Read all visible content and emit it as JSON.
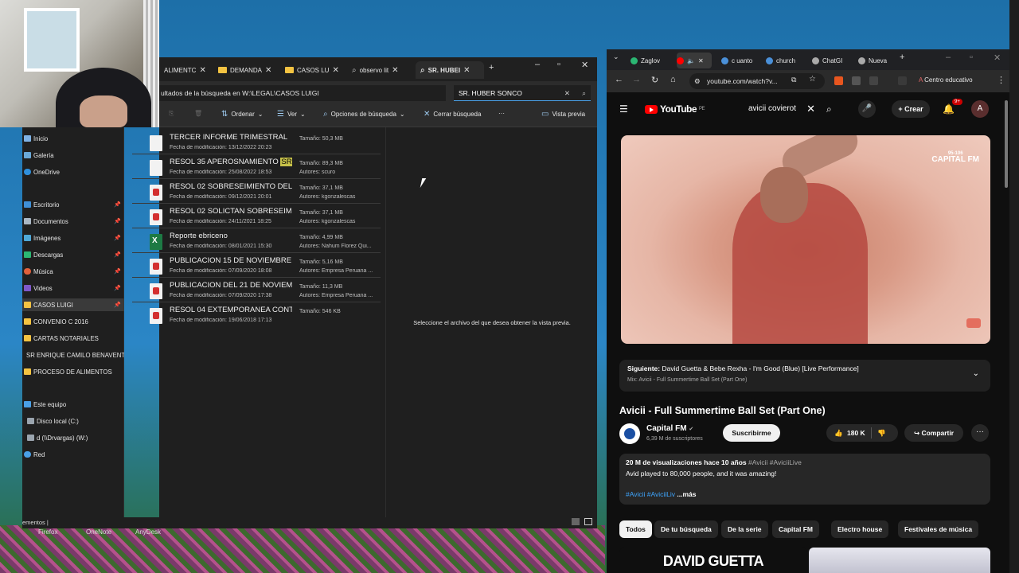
{
  "desktop": {
    "taskbar_labels": [
      "Firefox",
      "OneNote",
      "AnyDesk"
    ]
  },
  "explorer": {
    "tabs": [
      {
        "label": "ALIMENTC",
        "icon": "folder-icon"
      },
      {
        "label": "DEMANDA",
        "icon": "folder-icon"
      },
      {
        "label": "CASOS LU",
        "icon": "folder-icon"
      },
      {
        "label": "observo lit",
        "icon": "search-icon"
      },
      {
        "label": "SR. HUBEI",
        "icon": "search-icon"
      }
    ],
    "address": "ultados de la búsqueda en W:\\LEGAL\\CASOS LUIGI",
    "search_value": "SR. HUBER SONCO",
    "toolbar": {
      "sort": "Ordenar",
      "view": "Ver",
      "search_options": "Opciones de búsqueda",
      "close_search": "Cerrar búsqueda",
      "more": "···",
      "preview": "Vista previa"
    },
    "nav": [
      {
        "label": "Inicio",
        "icon": "home-icon",
        "pinned": false
      },
      {
        "label": "Galería",
        "icon": "gallery-icon",
        "pinned": false
      },
      {
        "label": "OneDrive",
        "icon": "cloud-icon",
        "pinned": false
      },
      {
        "label": "Escritorio",
        "icon": "desktop-icon",
        "pinned": true
      },
      {
        "label": "Documentos",
        "icon": "documents-icon",
        "pinned": true
      },
      {
        "label": "Imágenes",
        "icon": "images-icon",
        "pinned": true
      },
      {
        "label": "Descargas",
        "icon": "downloads-icon",
        "pinned": true
      },
      {
        "label": "Música",
        "icon": "music-icon",
        "pinned": true
      },
      {
        "label": "Videos",
        "icon": "videos-icon",
        "pinned": true
      },
      {
        "label": "CASOS LUIGI",
        "icon": "folder-icon",
        "pinned": true
      },
      {
        "label": "CONVENIO C 2016",
        "icon": "folder-icon",
        "pinned": false
      },
      {
        "label": "CARTAS NOTARIALES",
        "icon": "folder-icon",
        "pinned": false
      },
      {
        "label": "SR ENRIQUE CAMILO BENAVENTE",
        "icon": "folder-icon",
        "pinned": false
      },
      {
        "label": "PROCESO DE ALIMENTOS",
        "icon": "folder-icon",
        "pinned": false
      },
      {
        "label": "Este equipo",
        "icon": "computer-icon",
        "pinned": false
      },
      {
        "label": "Disco local (C:)",
        "icon": "drive-icon",
        "pinned": false
      },
      {
        "label": "d (\\\\Drvargas) (W:)",
        "icon": "network-drive-icon",
        "pinned": false
      },
      {
        "label": "Red",
        "icon": "network-icon",
        "pinned": false
      }
    ],
    "files": [
      {
        "name": "TERCER INFORME TRIMESTRAL",
        "highlight": "",
        "type": "doc",
        "date": "Fecha de modificación: 13/12/2022 20:23",
        "size": "Tamaño: 50,3 MB",
        "author": ""
      },
      {
        "name": "RESOL 35 APEROSNAMIENTO ",
        "highlight": "SR",
        "type": "doc",
        "date": "Fecha de modificación: 25/08/2022 18:53",
        "size": "Tamaño: 89,3 MB",
        "author": "Autores: scuro"
      },
      {
        "name": "RESOL 02 SOBRESEIMIENTO DEL ...",
        "highlight": "",
        "type": "pdf",
        "date": "Fecha de modificación: 09/12/2021 20:01",
        "size": "Tamaño: 37,1 MB",
        "author": "Autores: kgonzalescas"
      },
      {
        "name": "RESOL 02 SOLICTAN SOBRESEIMI...",
        "highlight": "",
        "type": "pdf",
        "date": "Fecha de modificación: 24/11/2021 18:25",
        "size": "Tamaño: 37,1 MB",
        "author": "Autores: kgonzalescas"
      },
      {
        "name": "Reporte ebriceno",
        "highlight": "",
        "type": "xls",
        "date": "Fecha de modificación: 08/01/2021 15:30",
        "size": "Tamaño: 4,99 MB",
        "author": "Autores: Nahum Florez Qui..."
      },
      {
        "name": "PUBLICACION 15 DE NOVIEMBRE",
        "highlight": "",
        "type": "pdf",
        "date": "Fecha de modificación: 07/09/2020 18:08",
        "size": "Tamaño: 5,16 MB",
        "author": "Autores: Empresa Peruana ..."
      },
      {
        "name": "PUBLICACION DEL 21 DE NOVIEM...",
        "highlight": "",
        "type": "pdf",
        "date": "Fecha de modificación: 07/09/2020 17:38",
        "size": "Tamaño: 11,3 MB",
        "author": "Autores: Empresa Peruana ..."
      },
      {
        "name": "RESOL 04 EXTEMPORANEA CONT...",
        "highlight": "",
        "type": "pdf",
        "date": "Fecha de modificación: 19/06/2018 17:13",
        "size": "Tamaño: 546 KB",
        "author": ""
      }
    ],
    "preview_message": "Seleccione el archivo del que desea obtener la vista previa.",
    "status": "ementos |"
  },
  "browser": {
    "tabs": [
      {
        "label": "Zaglov",
        "color": "#2bb673"
      },
      {
        "label": "",
        "color": "#ff0000"
      },
      {
        "label": "c uanto",
        "color": "#4a90d9"
      },
      {
        "label": "church",
        "color": "#4a90d9"
      },
      {
        "label": "ChatGI",
        "color": "#aaaaaa"
      },
      {
        "label": "Nueva",
        "color": "#aaaaaa"
      }
    ],
    "url": "youtube.com/watch?v...",
    "profile_label": "Centro educativo"
  },
  "youtube": {
    "logo": "YouTube",
    "region": "PE",
    "search_value": "avicii covierot",
    "create_label": "Crear",
    "notif_count": "9+",
    "avatar_letter": "A",
    "video_badge_top": "95-106",
    "video_badge": "CAPITAL FM",
    "up_next_label": "Siguiente:",
    "up_next_title": "David Guetta & Bebe Rexha - I'm Good (Blue) [Live Performance]",
    "mix_label": "Mix: Avicii - Full Summertime Ball Set (Part One)",
    "title": "Avicii - Full Summertime Ball Set (Part One)",
    "channel": "Capital FM",
    "verified": "✔",
    "subscribers": "6,39 M de suscriptores",
    "subscribe_label": "Suscribirme",
    "likes": "180 K",
    "share_label": "Compartir",
    "views_meta": "20 M de visualizaciones  hace 10 años ",
    "hashtags_meta": "#Avicii #AviciiLive",
    "description": "Avid played to 80,000 people, and it was amazing!",
    "desc_tags": "#Avicii #AviciiLiv",
    "more_label": " ...más",
    "chips": [
      "Todos",
      "De tu búsqueda",
      "De la serie",
      "Capital FM",
      "Electro house",
      "Festivales de música"
    ],
    "rec_thumb_text": "DAVID GUETTA"
  }
}
